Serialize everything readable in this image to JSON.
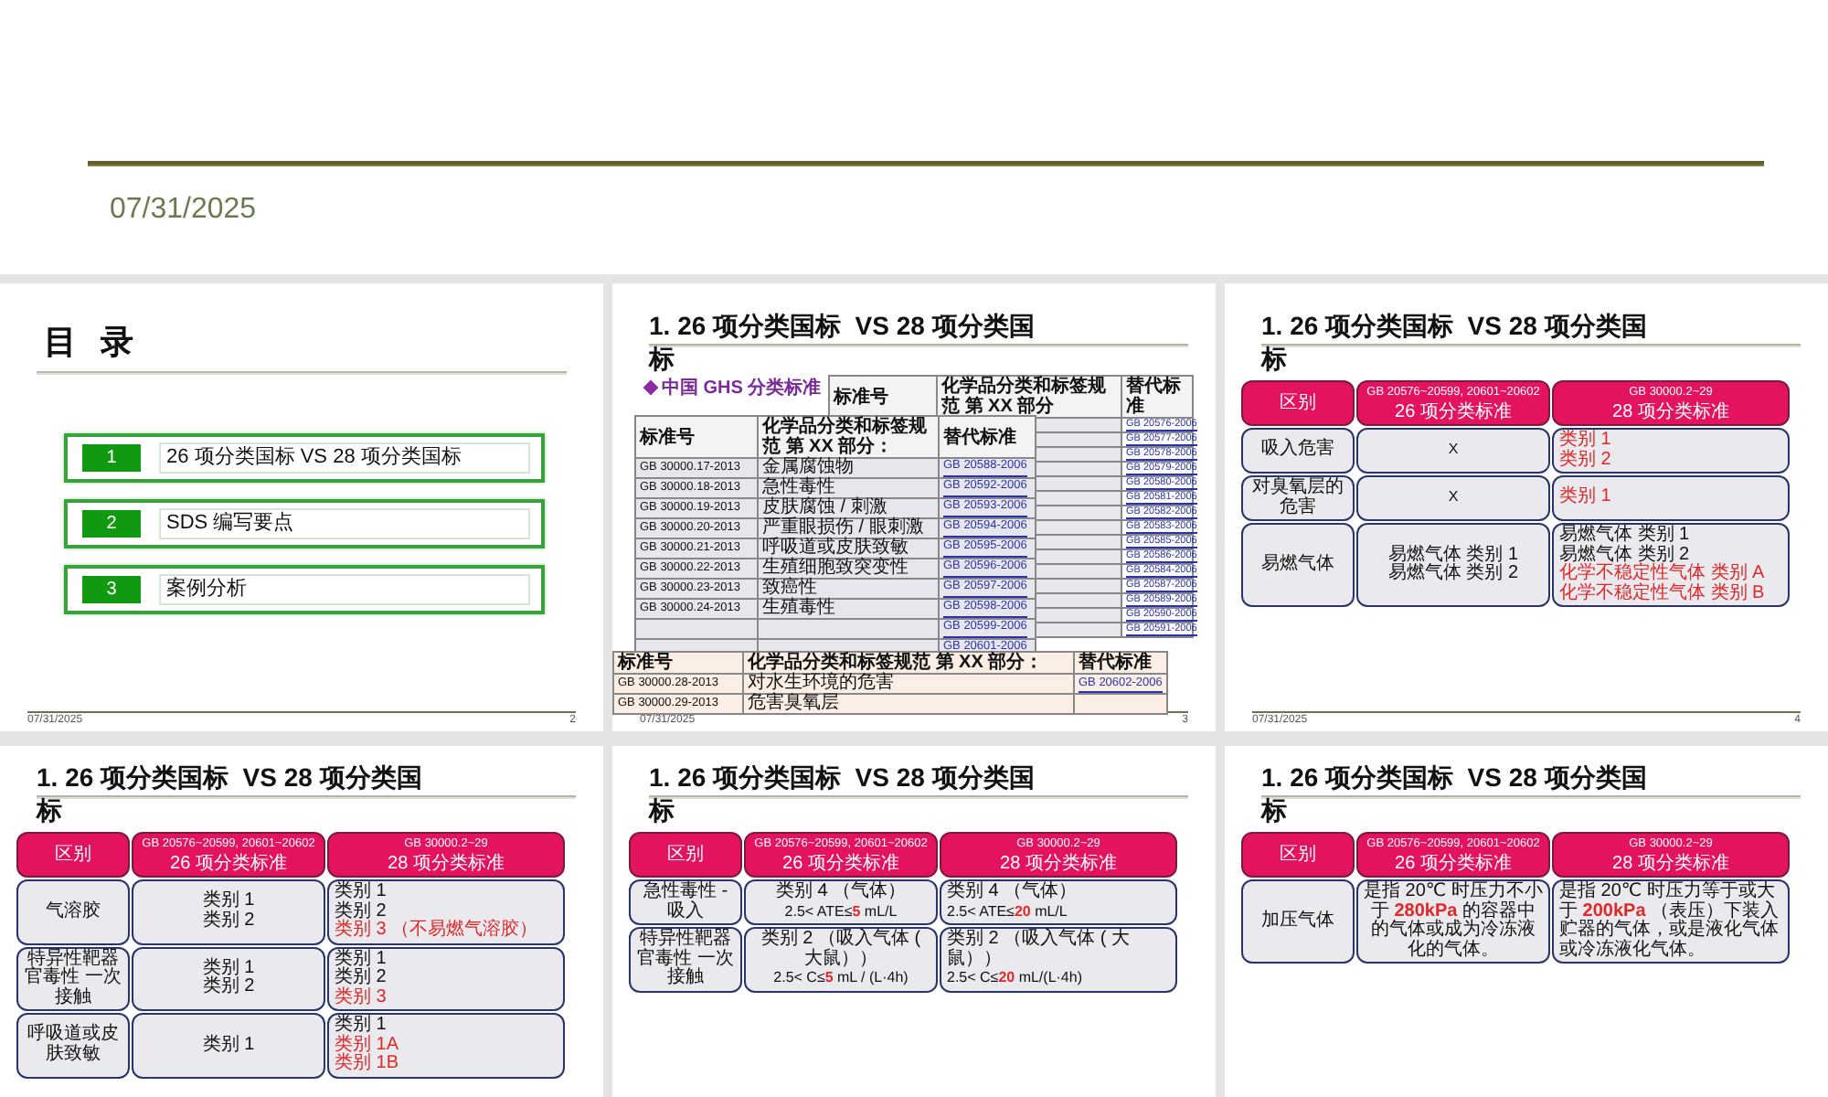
{
  "title_slide": {
    "date": "07/31/2025"
  },
  "slides": [
    {
      "kind": "contents",
      "title": "目 录",
      "items": [
        {
          "number": "1",
          "text": "26 项分类国标 VS 28 项分类国标"
        },
        {
          "number": "2",
          "text": "SDS 编写要点"
        },
        {
          "number": "3",
          "text": "案例分析"
        }
      ],
      "date": "07/31/2025",
      "page": "2"
    },
    {
      "kind": "tables",
      "title": "1. 26 项分类国标  VS 28 项分类国标",
      "subtitle": "中国 GHS 分类标准",
      "back_table": {
        "columns": [
          "标准号",
          "化学品分类和标签规范 第 XX 部分",
          "替代标准"
        ],
        "links": [
          "GB 20576-2006",
          "GB 20577-2006",
          "GB 20578-2006",
          "GB 20579-2006",
          "GB 20580-2006",
          "GB 20581-2006",
          "GB 20582-2006",
          "GB 20583-2006",
          "GB 20585-2006",
          "GB 20586-2006",
          "GB 20584-2006",
          "GB 20587-2006",
          "GB 20589-2006",
          "GB 20590-2006",
          "GB 20591-2006"
        ]
      },
      "main_table": {
        "columns": [
          "标准号",
          "化学品分类和标签规范 第 XX 部分：",
          "替代标准"
        ],
        "rows": [
          {
            "code": "GB 30000.17-2013",
            "name": "金属腐蚀物",
            "link": "GB 20588-2006"
          },
          {
            "code": "GB 30000.18-2013",
            "name": "急性毒性",
            "link": "GB 20592-2006"
          },
          {
            "code": "GB 30000.19-2013",
            "name": "皮肤腐蚀 / 刺激",
            "link": "GB 20593-2006"
          },
          {
            "code": "GB 30000.20-2013",
            "name": "严重眼损伤 / 眼刺激",
            "link": "GB 20594-2006"
          },
          {
            "code": "GB 30000.21-2013",
            "name": "呼吸道或皮肤致敏",
            "link": "GB 20595-2006"
          },
          {
            "code": "GB 30000.22-2013",
            "name": "生殖细胞致突变性",
            "link": "GB 20596-2006"
          },
          {
            "code": "GB 30000.23-2013",
            "name": "致癌性",
            "link": "GB 20597-2006"
          },
          {
            "code": "GB 30000.24-2013",
            "name": "生殖毒性",
            "link": "GB 20598-2006"
          },
          {
            "link": "GB 20599-2006"
          },
          {
            "link": "GB 20601-2006"
          }
        ]
      },
      "front_table": {
        "columns": [
          "标准号",
          "化学品分类和标签规范 第 XX 部分：",
          "替代标准"
        ],
        "rows": [
          {
            "code": "GB 30000.28-2013",
            "name": "对水生环境的危害",
            "link": "GB 20602-2006"
          },
          {
            "code": "GB 30000.29-2013",
            "name": "危害臭氧层"
          }
        ]
      },
      "date": "07/31/2025",
      "page": "3"
    },
    {
      "kind": "comparison",
      "title": "1. 26 项分类国标  VS 28 项分类国标",
      "columns": [
        [
          "区别"
        ],
        [
          "GB 20576~20599, 20601~20602",
          "26 项分类标准"
        ],
        [
          "GB 30000.2~29",
          "28 项分类标准"
        ]
      ],
      "rows": [
        {
          "label": "吸入危害",
          "old": [
            {
              "text": "X",
              "changed": false
            }
          ],
          "new": [
            {
              "text": "类别 1",
              "changed": true
            },
            {
              "text": "类别 2",
              "changed": true
            }
          ]
        },
        {
          "label": "对臭氧层的危害",
          "old": [
            {
              "text": "X",
              "changed": false
            }
          ],
          "new": [
            {
              "text": "类别 1",
              "changed": true
            }
          ]
        },
        {
          "label": "易燃气体",
          "old": [
            {
              "text": "易燃气体  类别 1",
              "changed": false
            },
            {
              "text": "易燃气体  类别 2",
              "changed": false
            }
          ],
          "new": [
            {
              "text": "易燃气体  类别 1",
              "changed": false
            },
            {
              "text": "易燃气体  类别 2",
              "changed": false
            },
            {
              "text": "化学不稳定性气体  类别 A",
              "changed": true
            },
            {
              "text": "化学不稳定性气体  类别 B",
              "changed": true
            }
          ]
        }
      ],
      "date": "07/31/2025",
      "page": "4"
    },
    {
      "kind": "comparison",
      "title": "1. 26 项分类国标  VS 28 项分类国标",
      "columns": [
        [
          "区别"
        ],
        [
          "GB 20576~20599, 20601~20602",
          "26 项分类标准"
        ],
        [
          "GB 30000.2~29",
          "28 项分类标准"
        ]
      ],
      "rows": [
        {
          "label": "气溶胶",
          "old": [
            {
              "text": "类别 1",
              "changed": false
            },
            {
              "text": "类别 2",
              "changed": false
            }
          ],
          "new": [
            {
              "text": "类别 1",
              "changed": false
            },
            {
              "text": "类别 2",
              "changed": false
            },
            {
              "text": "类别 3 （不易燃气溶胶）",
              "changed": true
            }
          ]
        },
        {
          "label": "特异性靶器官毒性 一次接触",
          "old": [
            {
              "text": "类别 1",
              "changed": false
            },
            {
              "text": "类别 2",
              "changed": false
            }
          ],
          "new": [
            {
              "text": "类别 1",
              "changed": false
            },
            {
              "text": "类别 2",
              "changed": false
            },
            {
              "text": "类别 3",
              "changed": true
            }
          ]
        },
        {
          "label": "呼吸道或皮肤致敏",
          "old": [
            {
              "text": "类别 1",
              "changed": false
            }
          ],
          "new": [
            {
              "text": "类别 1",
              "changed": false
            },
            {
              "text": "类别 1A",
              "changed": true
            },
            {
              "text": "类别 1B",
              "changed": true
            }
          ]
        }
      ]
    },
    {
      "kind": "comparison",
      "title": "1. 26 项分类国标  VS 28 项分类国标",
      "columns": [
        [
          "区别"
        ],
        [
          "GB 20576~20599, 20601~20602",
          "26 项分类标准"
        ],
        [
          "GB 30000.2~29",
          "28 项分类标准"
        ]
      ],
      "rows": [
        {
          "label": "急性毒性 - 吸入",
          "old": [
            {
              "text": "类别 4 （气体）",
              "changed": false
            },
            {
              "text": "2.5< ATE≤**5** mL/L",
              "changed": false
            }
          ],
          "new": [
            {
              "text": "类别 4 （气体）",
              "changed": false
            },
            {
              "text": "2.5< ATE≤**20** mL/L",
              "changed": false
            }
          ]
        },
        {
          "label": "特异性靶器官毒性 一次接触",
          "old": [
            {
              "text": "类别 2 （吸入气体 ( 大鼠））",
              "changed": false
            },
            {
              "text": "2.5< C≤**5** mL / (L·4h)",
              "changed": false
            }
          ],
          "new": [
            {
              "text": "类别 2 （吸入气体 ( 大鼠））",
              "changed": false
            },
            {
              "text": "2.5< C≤**20** mL/(L·4h)",
              "changed": false
            }
          ]
        }
      ]
    },
    {
      "kind": "comparison",
      "title": "1. 26 项分类国标  VS 28 项分类国标",
      "columns": [
        [
          "区别"
        ],
        [
          "GB 20576~20599, 20601~20602",
          "26 项分类标准"
        ],
        [
          "GB 30000.2~29",
          "28 项分类标准"
        ]
      ],
      "rows": [
        {
          "label": "加压气体",
          "old": [
            {
              "text": "是指 20℃ 时压力不小于 **280kPa** 的容器中的气体或成为冷冻液化的气体。",
              "changed": false
            }
          ],
          "new": [
            {
              "text": "是指 20℃ 时压力等于或大于 **200kPa** （表压）下装入贮器的气体，或是液化气体或冷冻液化气体。",
              "changed": false
            }
          ]
        }
      ]
    }
  ]
}
